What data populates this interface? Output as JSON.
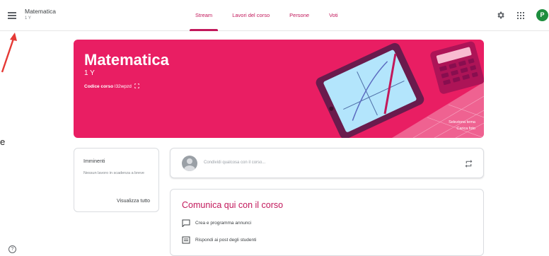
{
  "header": {
    "class_title": "Matematica",
    "class_section": "1 Y",
    "tabs": [
      {
        "label": "Stream",
        "active": true
      },
      {
        "label": "Lavori del corso",
        "active": false
      },
      {
        "label": "Persone",
        "active": false
      },
      {
        "label": "Voti",
        "active": false
      }
    ],
    "avatar_letter": "P",
    "icons": {
      "menu": "menu-icon",
      "settings": "gear-icon",
      "apps": "apps-grid-icon"
    }
  },
  "edge_text": "e",
  "banner": {
    "title": "Matematica",
    "section": "1 Y",
    "code_label": "Codice corso",
    "code_value": "l32wpzd",
    "select_theme": "Seleziona tema",
    "upload_photo": "Carica foto",
    "color": "#e91e63"
  },
  "upcoming": {
    "title": "Imminenti",
    "text": "Nessun lavoro in scadenza a breve",
    "link": "Visualizza tutto"
  },
  "share": {
    "placeholder": "Condividi qualcosa con il corso..."
  },
  "communicate": {
    "title": "Comunica qui con il corso",
    "items": [
      {
        "label": "Crea e programma annunci",
        "icon": "announcement-icon"
      },
      {
        "label": "Rispondi ai post degli studenti",
        "icon": "reply-icon"
      }
    ]
  },
  "colors": {
    "accent": "#c2185b",
    "avatar": "#1e8e3e",
    "annotation": "#e53935"
  }
}
